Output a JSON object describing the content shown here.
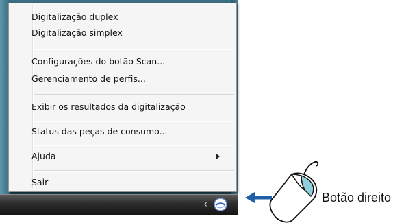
{
  "menu": {
    "items": [
      {
        "label": "Digitalização duplex"
      },
      {
        "label": "Digitalização simplex"
      },
      {
        "label": "Configurações do botão Scan..."
      },
      {
        "label": "Gerenciamento de perfis..."
      },
      {
        "label": "Exibir os resultados da digitalização"
      },
      {
        "label": "Status das peças de consumo..."
      },
      {
        "label": "Ajuda"
      },
      {
        "label": "Sair"
      }
    ]
  },
  "caption": "Botão direito",
  "colors": {
    "arrow": "#1f5fa8",
    "mouse_button": "#8fd0dc"
  },
  "icons": {
    "tray": "scanner-tray-icon",
    "overflow": "chevron-left-icon",
    "pointer": "arrow-left-icon",
    "mouse": "mouse-icon"
  }
}
